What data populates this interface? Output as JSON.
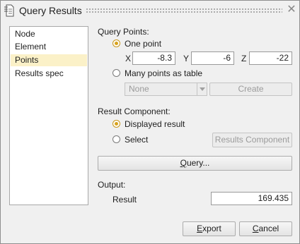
{
  "window": {
    "title": "Query Results",
    "close_glyph": "✕"
  },
  "nav": {
    "items": [
      "Node",
      "Element",
      "Points",
      "Results spec"
    ],
    "selected": "Points"
  },
  "query_points": {
    "heading": "Query Points:",
    "one_point_label": "One point",
    "x_label": "X",
    "x_value": "-8.3",
    "y_label": "Y",
    "y_value": "-6",
    "z_label": "Z",
    "z_value": "-22",
    "many_points_label": "Many points as table",
    "table_select_value": "None",
    "create_label": "Create"
  },
  "result_component": {
    "heading": "Result Component:",
    "displayed_label": "Displayed result",
    "select_label": "Select",
    "results_component_button": "Results Component"
  },
  "query_button": {
    "prefix": "",
    "mnemonic": "Q",
    "suffix": "uery..."
  },
  "output": {
    "heading": "Output:",
    "result_label": "Result",
    "result_value": "169.435"
  },
  "footer": {
    "export_mnemonic": "E",
    "export_rest": "xport",
    "cancel_mnemonic": "C",
    "cancel_rest": "ancel"
  },
  "colors": {
    "accent": "#d7a21c",
    "selection_bg": "#fbf1c8",
    "window_bg": "#f0f0f0"
  }
}
